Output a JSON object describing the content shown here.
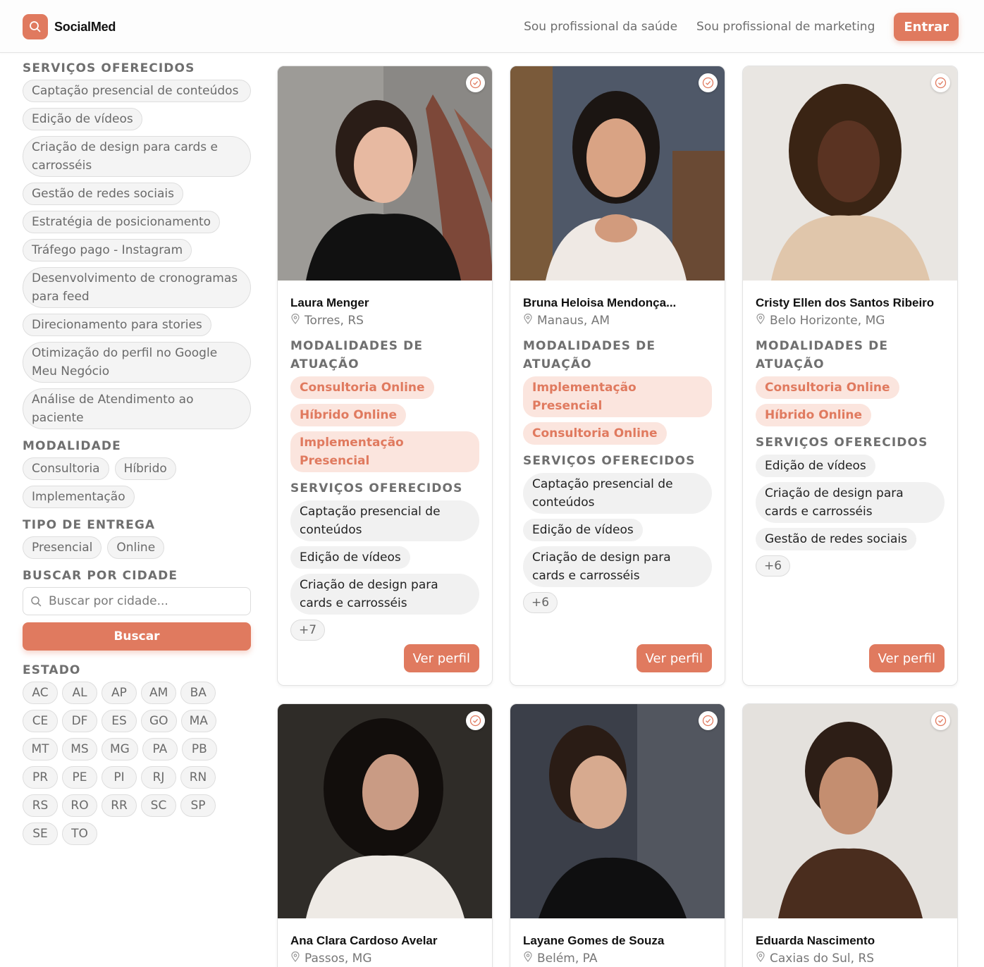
{
  "header": {
    "logo_text": "SocialMed",
    "nav": [
      "Sou profissional da saúde",
      "Sou profissional de marketing"
    ],
    "login_label": "Entrar"
  },
  "sidebar": {
    "services_title": "SERVIÇOS OFERECIDOS",
    "services": [
      "Captação presencial de conteúdos",
      "Edição de vídeos",
      "Criação de design para cards e carrosséis",
      "Gestão de redes sociais",
      "Estratégia de posicionamento",
      "Tráfego pago - Instagram",
      "Desenvolvimento de cronogramas para feed",
      "Direcionamento para stories",
      "Otimização do perfil no Google Meu Negócio",
      "Análise de Atendimento ao paciente"
    ],
    "modality_title": "MODALIDADE",
    "modalities": [
      "Consultoria",
      "Híbrido",
      "Implementação"
    ],
    "delivery_title": "TIPO DE ENTREGA",
    "deliveries": [
      "Presencial",
      "Online"
    ],
    "city_title": "BUSCAR POR CIDADE",
    "city_placeholder": "Buscar por cidade...",
    "search_label": "Buscar",
    "state_title": "ESTADO",
    "states": [
      "AC",
      "AL",
      "AP",
      "AM",
      "BA",
      "CE",
      "DF",
      "ES",
      "GO",
      "MA",
      "MT",
      "MS",
      "MG",
      "PA",
      "PB",
      "PR",
      "PE",
      "PI",
      "RJ",
      "RN",
      "RS",
      "RO",
      "RR",
      "SC",
      "SP",
      "SE",
      "TO"
    ]
  },
  "card_labels": {
    "modalities_title": "MODALIDADES DE ATUAÇÃO",
    "services_title": "SERVIÇOS OFERECIDOS",
    "profile_button": "Ver perfil"
  },
  "colors": {
    "accent": "#e07a5f",
    "accent_soft": "#fbe5de"
  },
  "professionals": [
    {
      "name": "Laura Menger",
      "location": "Torres, RS",
      "modalities": [
        "Consultoria Online",
        "Híbrido Online",
        "Implementação Presencial"
      ],
      "services": [
        "Captação presencial de conteúdos",
        "Edição de vídeos",
        "Criação de design para cards e carrosséis"
      ],
      "more": "+7"
    },
    {
      "name": "Bruna Heloisa Mendonça...",
      "location": "Manaus, AM",
      "modalities": [
        "Implementação Presencial",
        "Consultoria Online"
      ],
      "services": [
        "Captação presencial de conteúdos",
        "Edição de vídeos",
        "Criação de design para cards e carrosséis"
      ],
      "more": "+6"
    },
    {
      "name": "Cristy Ellen dos Santos Ribeiro",
      "location": "Belo Horizonte, MG",
      "modalities": [
        "Consultoria Online",
        "Híbrido Online"
      ],
      "services": [
        "Edição de vídeos",
        "Criação de design para cards e carrosséis",
        "Gestão de redes sociais"
      ],
      "more": "+6"
    },
    {
      "name": "Ana Clara Cardoso Avelar",
      "location": "Passos, MG"
    },
    {
      "name": "Layane Gomes de Souza",
      "location": "Belém, PA"
    },
    {
      "name": "Eduarda Nascimento",
      "location": "Caxias do Sul, RS"
    }
  ]
}
